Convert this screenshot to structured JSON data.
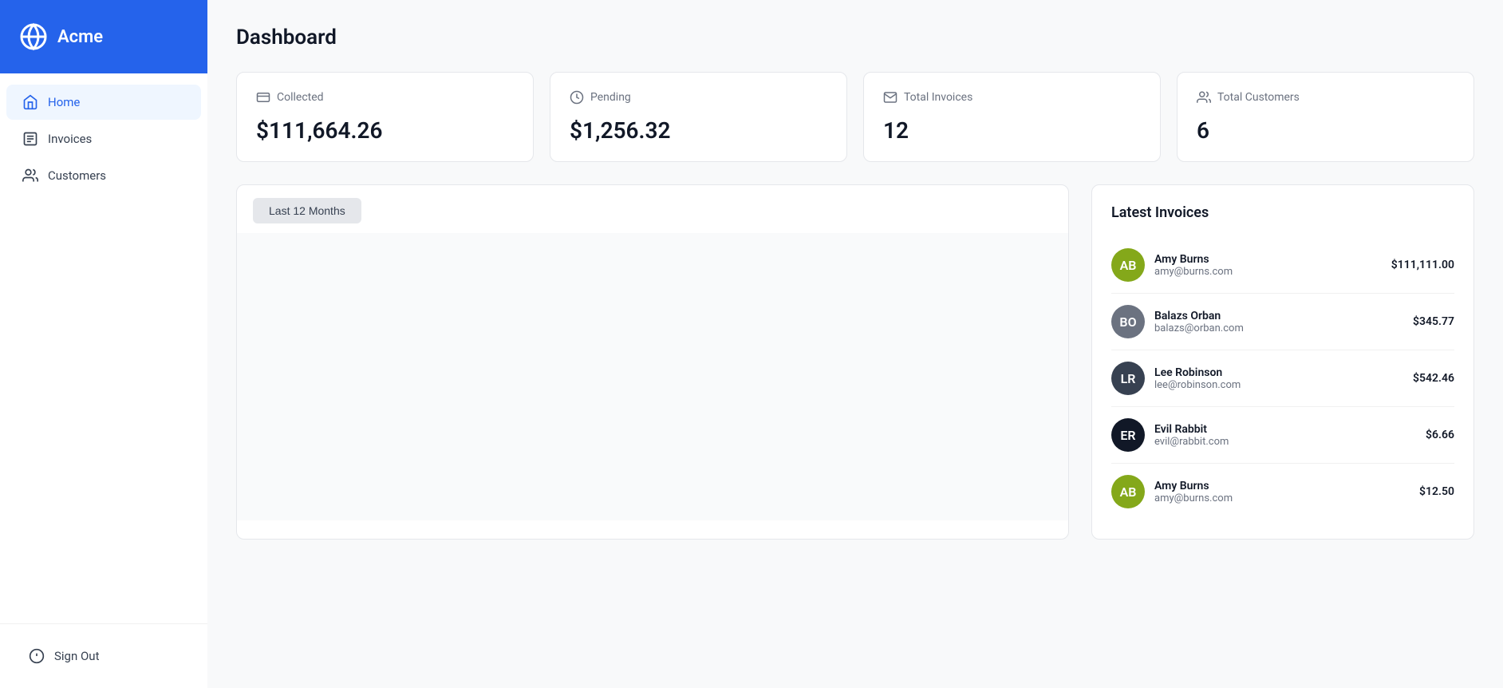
{
  "sidebar": {
    "logo": {
      "text": "Acme"
    },
    "nav": [
      {
        "id": "home",
        "label": "Home",
        "active": true
      },
      {
        "id": "invoices",
        "label": "Invoices",
        "active": false
      },
      {
        "id": "customers",
        "label": "Customers",
        "active": false
      }
    ],
    "signout_label": "Sign Out"
  },
  "main": {
    "page_title": "Dashboard",
    "stats": [
      {
        "id": "collected",
        "label": "Collected",
        "value": "$111,664.26"
      },
      {
        "id": "pending",
        "label": "Pending",
        "value": "$1,256.32"
      },
      {
        "id": "total_invoices",
        "label": "Total Invoices",
        "value": "12"
      },
      {
        "id": "total_customers",
        "label": "Total Customers",
        "value": "6"
      }
    ],
    "chart_filter_label": "Last 12 Months",
    "latest_invoices_title": "Latest Invoices",
    "invoices": [
      {
        "id": 1,
        "name": "Amy Burns",
        "email": "amy@burns.com",
        "amount": "$111,111.00",
        "initials": "AB",
        "color": "#84a81a"
      },
      {
        "id": 2,
        "name": "Balazs Orban",
        "email": "balazs@orban.com",
        "amount": "$345.77",
        "initials": "BO",
        "color": "#6b7280"
      },
      {
        "id": 3,
        "name": "Lee Robinson",
        "email": "lee@robinson.com",
        "amount": "$542.46",
        "initials": "LR",
        "color": "#374151"
      },
      {
        "id": 4,
        "name": "Evil Rabbit",
        "email": "evil@rabbit.com",
        "amount": "$6.66",
        "initials": "ER",
        "color": "#111827"
      },
      {
        "id": 5,
        "name": "Amy Burns",
        "email": "amy@burns.com",
        "amount": "$12.50",
        "initials": "AB",
        "color": "#84a81a"
      }
    ]
  }
}
